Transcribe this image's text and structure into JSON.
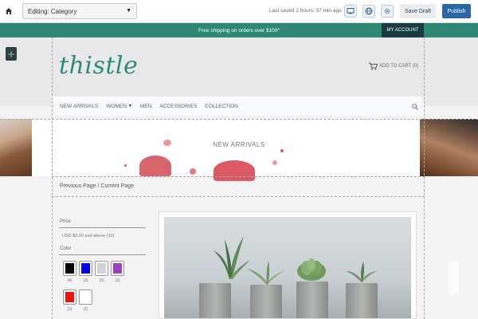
{
  "editor": {
    "editing_label": "Editing: Category",
    "last_saved": "Last saved 2 hours, 37 min ago",
    "save_draft": "Save Draft",
    "publish": "Publish",
    "icons": [
      "home-icon",
      "desktop-icon",
      "globe-icon",
      "gear-icon"
    ]
  },
  "announcement": {
    "text": "Free shipping on orders over $100*",
    "account": "MY ACCOUNT"
  },
  "store": {
    "logo": "thistle",
    "cart": "ADD TO CART (0)"
  },
  "nav": {
    "items": [
      "NEW ARRIVALS",
      "WOMEN",
      "MEN",
      "ACCESSORIES",
      "COLLECTION"
    ]
  },
  "banner": {
    "title": "NEW ARRIVALS"
  },
  "breadcrumb": {
    "previous": "Previous Page",
    "separator": "/",
    "current": "Current Page"
  },
  "filters": {
    "price_label": "Price",
    "price_value": "USD $0.00 and above (10)",
    "color_label": "Color",
    "swatches": [
      {
        "color": "#000000",
        "count": "(4)"
      },
      {
        "color": "#0000ee",
        "count": "(3)"
      },
      {
        "color": "#cfd4dc",
        "count": "(3)"
      },
      {
        "color": "#9b3fc4",
        "count": "(3)"
      },
      {
        "color": "#ee1111",
        "count": "(3)"
      },
      {
        "color": "#ffffff",
        "count": "(1)"
      }
    ]
  },
  "colors": {
    "accent": "#2d8874",
    "publish": "#2868a8",
    "logo": "#2b8a82"
  }
}
